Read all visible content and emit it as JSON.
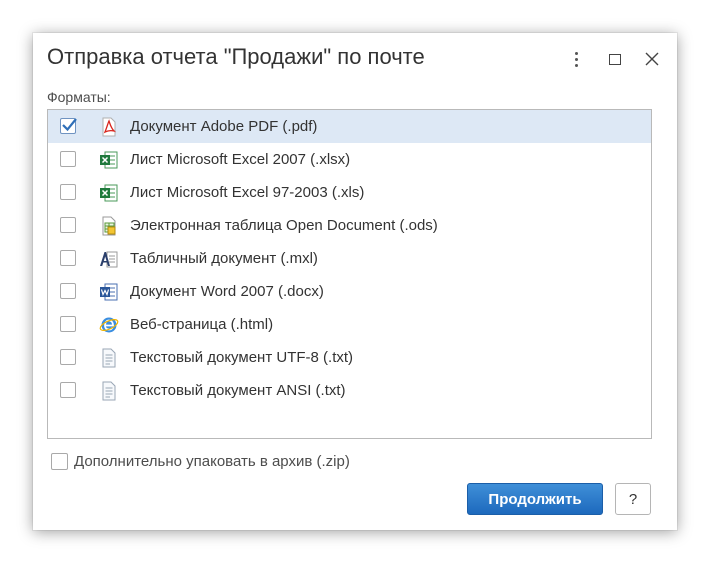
{
  "dialog": {
    "title": "Отправка отчета \"Продажи\" по почте",
    "more_icon": "more-vertical-icon",
    "maximize_icon": "maximize-icon",
    "close_icon": "close-icon"
  },
  "formats_label": "Форматы:",
  "formats": [
    {
      "label": "Документ Adobe PDF (.pdf)",
      "checked": true,
      "icon": "pdf-icon"
    },
    {
      "label": "Лист Microsoft Excel 2007 (.xlsx)",
      "checked": false,
      "icon": "excel-icon"
    },
    {
      "label": "Лист Microsoft Excel 97-2003 (.xls)",
      "checked": false,
      "icon": "excel-icon"
    },
    {
      "label": "Электронная таблица Open Document (.ods)",
      "checked": false,
      "icon": "ods-spreadsheet-icon"
    },
    {
      "label": "Табличный документ (.mxl)",
      "checked": false,
      "icon": "mxl-document-icon"
    },
    {
      "label": "Документ Word 2007 (.docx)",
      "checked": false,
      "icon": "word-icon"
    },
    {
      "label": "Веб-страница (.html)",
      "checked": false,
      "icon": "web-page-icon"
    },
    {
      "label": "Текстовый документ UTF-8 (.txt)",
      "checked": false,
      "icon": "text-file-icon"
    },
    {
      "label": "Текстовый документ ANSI (.txt)",
      "checked": false,
      "icon": "text-file-icon"
    }
  ],
  "zip": {
    "label": "Дополнительно упаковать в архив (.zip)",
    "checked": false
  },
  "buttons": {
    "continue": "Продолжить",
    "help": "?"
  },
  "colors": {
    "accent": "#1d69bd",
    "selected_row": "#dde8f5",
    "check": "#2f6fb8"
  }
}
